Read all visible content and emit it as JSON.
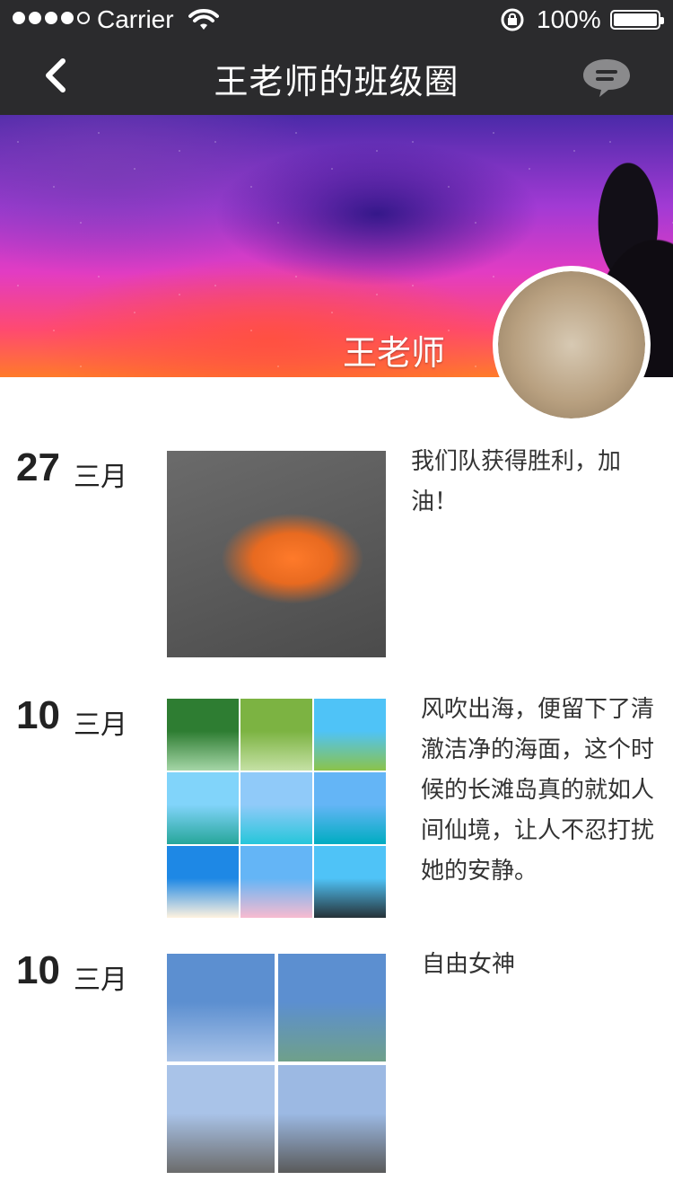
{
  "status_bar": {
    "carrier": "Carrier",
    "battery_percent": "100%",
    "signal_bars_filled": 4,
    "signal_bars_total": 5
  },
  "nav": {
    "title": "王老师的班级圈",
    "back_icon": "chevron-left-icon",
    "chat_icon": "chat-bubble-icon"
  },
  "cover": {
    "name": "王老师"
  },
  "feed": [
    {
      "day": "27",
      "month": "三月",
      "text": "我们队获得胜利，加油！",
      "images": [
        {
          "kind": "team-photo",
          "colors": [
            "#ff7a2a",
            "#4b4b4b"
          ]
        }
      ]
    },
    {
      "day": "10",
      "month": "三月",
      "text": "风吹出海，便留下了清澈洁净的海面，这个时候的长滩岛真的就如人间仙境，让人不忍打扰她的安静。",
      "images": [
        {
          "kind": "park-crowd",
          "colors": [
            "#2e7d32",
            "#a5d6a7"
          ]
        },
        {
          "kind": "circle-of-people",
          "colors": [
            "#7cb342",
            "#c5e1a5"
          ]
        },
        {
          "kind": "tree-field",
          "colors": [
            "#4fc3f7",
            "#8bc34a"
          ]
        },
        {
          "kind": "sea",
          "colors": [
            "#81d4fa",
            "#26a69a"
          ]
        },
        {
          "kind": "sea",
          "colors": [
            "#90caf9",
            "#26c6da"
          ]
        },
        {
          "kind": "sea-pier",
          "colors": [
            "#64b5f6",
            "#00acc1"
          ]
        },
        {
          "kind": "beach",
          "colors": [
            "#1e88e5",
            "#fff3e0"
          ]
        },
        {
          "kind": "anime-sky",
          "colors": [
            "#64b5f6",
            "#f8bbd0"
          ]
        },
        {
          "kind": "dusk-sea",
          "colors": [
            "#4fc3f7",
            "#263238"
          ]
        }
      ]
    },
    {
      "day": "10",
      "month": "三月",
      "text": "自由女神",
      "images": [
        {
          "kind": "sky-pole",
          "colors": [
            "#5c8fd0",
            "#a9c3e8"
          ]
        },
        {
          "kind": "statue-liberty",
          "colors": [
            "#5c8fd0",
            "#6fa08a"
          ]
        },
        {
          "kind": "bare-trees",
          "colors": [
            "#a9c3e8",
            "#6b6b6b"
          ]
        },
        {
          "kind": "statue-base",
          "colors": [
            "#9cb9e3",
            "#5a5a5a"
          ]
        }
      ]
    }
  ]
}
